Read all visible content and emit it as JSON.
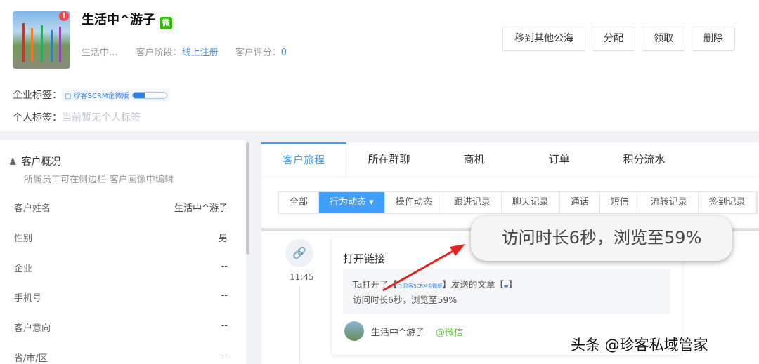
{
  "customer": {
    "name": "生活中^游子",
    "short_name": "生活中...",
    "stage_label": "客户阶段：",
    "stage": "线上注册",
    "score_label": "客户评分：",
    "score": "0",
    "alert": "!",
    "wechat": "微"
  },
  "actions": [
    "移到其他公海",
    "分配",
    "领取",
    "删除"
  ],
  "tags": {
    "enterprise_label": "企业标签：",
    "enterprise_tag": "▢ 珍客SCRM企微版",
    "personal_label": "个人标签：",
    "personal_empty": "当前暂无个人标签"
  },
  "overview": {
    "title": "客户概况",
    "subtitle": "所属员工可在侧边栏-客户画像中编辑",
    "fields": [
      {
        "label": "客户姓名",
        "value": "生活中^游子"
      },
      {
        "label": "性别",
        "value": "男"
      },
      {
        "label": "企业",
        "value": "--"
      },
      {
        "label": "手机号",
        "value": "--"
      },
      {
        "label": "客户意向",
        "value": "--"
      },
      {
        "label": "省/市/区",
        "value": "--"
      }
    ]
  },
  "tabs": [
    "客户旅程",
    "所在群聊",
    "商机",
    "订单",
    "积分流水"
  ],
  "filters": [
    "全部",
    "行为动态 ▾",
    "操作动态",
    "跟进记录",
    "聊天记录",
    "通话",
    "短信",
    "流转记录",
    "签到记录"
  ],
  "timeline": {
    "time": "11:45",
    "title": "打开链接",
    "line1_a": "Ta打开了【",
    "line1_tag": "▢ 珍客SCRM企微版",
    "line1_b": "】发送的文章【",
    "line1_c": "】",
    "line2": "访问时长6秒，浏览至59%",
    "user": "生活中^游子",
    "source": "@微信"
  },
  "callout": "访问时长6秒，浏览至59%",
  "watermark": "头条 @珍客私域管家"
}
